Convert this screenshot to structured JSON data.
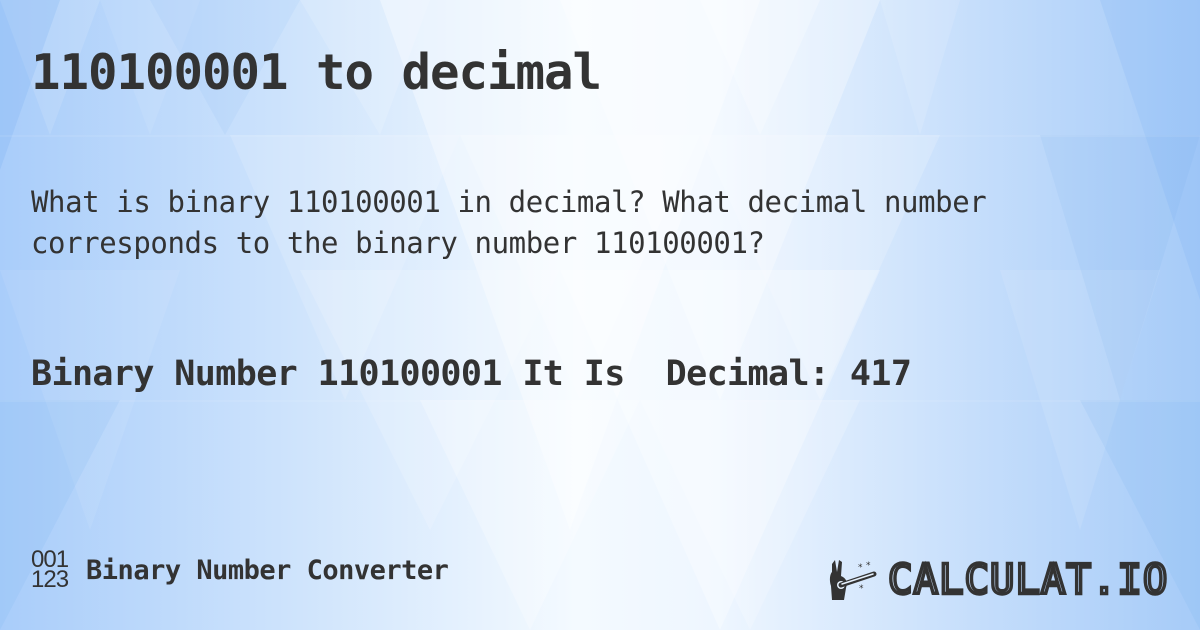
{
  "page": {
    "title": "110100001 to decimal",
    "question": "What is binary 110100001 in decimal? What decimal number corresponds to the binary number 110100001?",
    "answer": "Binary Number 110100001 It Is  Decimal: 417"
  },
  "footer": {
    "binary_icon_top": "001",
    "binary_icon_bottom": "123",
    "converter_name": "Binary Number Converter",
    "logo_text": "CALCULAT.IO"
  },
  "icons": {
    "binary": "binary-digits-icon",
    "logo": "magic-wand-hand-icon"
  },
  "colors": {
    "text": "#333333",
    "background_light": "#f4faff",
    "background_blue": "#a9cdfa"
  }
}
